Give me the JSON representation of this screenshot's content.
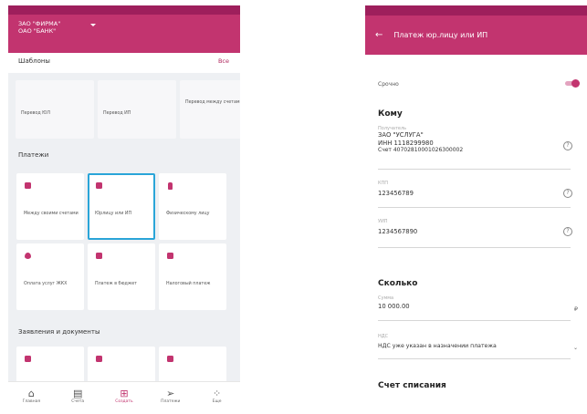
{
  "left": {
    "account": [
      "ЗАО \"ФИРМА\"",
      "ОАО \"БАНК\""
    ],
    "templates": {
      "title": "Шаблоны",
      "all_link": "Все",
      "items": [
        "Перевод ЮЛ",
        "Перевод ИП",
        "Перевод между счетами"
      ]
    },
    "payments": {
      "title": "Платежи",
      "items": [
        "Между своими счетами",
        "Юрлицу или ИП",
        "Физическому лицу",
        "Оплата услуг ЖКХ",
        "Платеж в бюджет",
        "Налоговый платеж"
      ]
    },
    "documents": {
      "title": "Заявления и документы"
    },
    "tabs": [
      "Главная",
      "Счета",
      "Создать",
      "Платежи",
      "Еще"
    ]
  },
  "right": {
    "header_title": "Платеж юр.лицу или ИП",
    "urgent_label": "Срочно",
    "urgent_on": true,
    "to_section": "Кому",
    "recipient": {
      "label": "Получатель",
      "name": "ЗАО \"УСЛУГА\"",
      "inn": "ИНН 1118299980",
      "account": "Счет 40702810001026300002"
    },
    "kpp": {
      "label": "КПП",
      "value": "123456789"
    },
    "uip": {
      "label": "УИП",
      "value": "1234567890"
    },
    "amount_section": "Сколько",
    "amount": {
      "label": "Сумма",
      "value": "10 000.00",
      "currency": "₽"
    },
    "vat": {
      "label": "НДС",
      "value": "НДС уже указан в назначении платежа"
    },
    "debit_section": "Счет списания"
  },
  "colors": {
    "brand": "#c2346f",
    "brand_dark": "#9e1f5c",
    "highlight": "#2aa5d8"
  }
}
